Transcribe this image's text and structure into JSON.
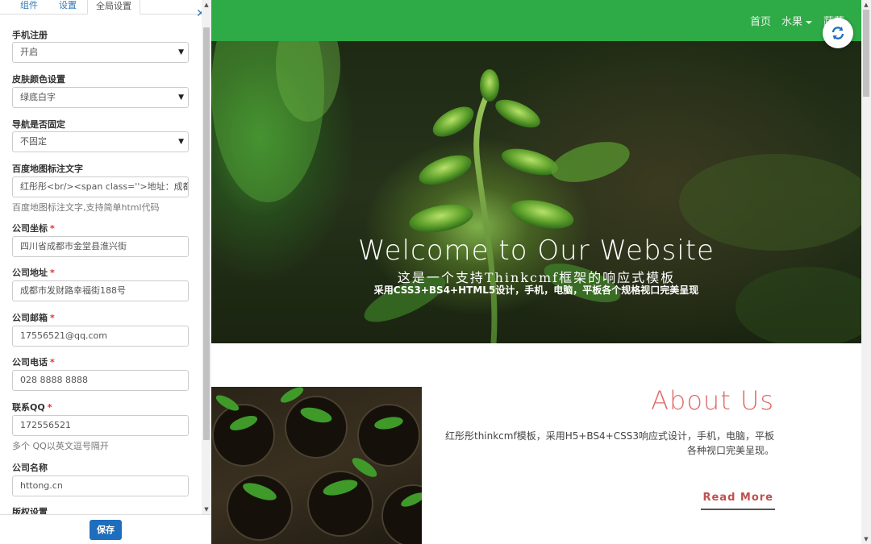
{
  "panel": {
    "tabs": [
      "组件",
      "设置",
      "全局设置"
    ],
    "fields": [
      {
        "label": "手机注册",
        "type": "select",
        "value": "开启",
        "required": false
      },
      {
        "label": "皮肤颜色设置",
        "type": "select",
        "value": "绿底白字",
        "required": false
      },
      {
        "label": "导航是否固定",
        "type": "select",
        "value": "不固定",
        "required": false
      },
      {
        "label": "百度地图标注文字",
        "type": "input",
        "value": "红彤彤<br/><span class=''>地址：成都市",
        "help": "百度地图标注文字,支持简单html代码",
        "required": false
      },
      {
        "label": "公司坐标",
        "type": "input",
        "value": "四川省成都市金堂县淮兴街",
        "required": true
      },
      {
        "label": "公司地址",
        "type": "input",
        "value": "成都市发财路幸福街188号",
        "required": true
      },
      {
        "label": "公司邮箱",
        "type": "input",
        "value": "17556521@qq.com",
        "required": true
      },
      {
        "label": "公司电话",
        "type": "input",
        "value": "028 8888 8888",
        "required": true
      },
      {
        "label": "联系QQ",
        "type": "input",
        "value": "172556521",
        "help": "多个 QQ以英文逗号隔开",
        "required": true
      },
      {
        "label": "公司名称",
        "type": "input",
        "value": "httong.cn",
        "required": false
      },
      {
        "label": "版权设置",
        "type": "label",
        "required": false
      }
    ],
    "required_mark": "*",
    "save_label": "保存"
  },
  "site": {
    "nav": {
      "home": "首页",
      "fruit": "水果",
      "vegetable": "蔬菜"
    },
    "hero": {
      "title": "Welcome to Our Website",
      "subtitle": "这是一个支持Thinkcmf框架的响应式模板",
      "description": "采用CSS3+BS4+HTML5设计，手机，电脑，平板各个规格视口完美呈现"
    },
    "about": {
      "title": "About Us",
      "text_line1": "红彤彤thinkcmf模板，采用H5+BS4+CSS3响应式设计，手机，电脑，平板",
      "text_line2": "各种视口完美呈现。",
      "read_more": "Read More"
    }
  },
  "colors": {
    "navbar": "#2eaa47",
    "save_button": "#1e6ebd",
    "about_title": "#e06a6a",
    "read_more": "#c0504d"
  },
  "icons": {
    "close": "close-icon",
    "refresh": "refresh-icon",
    "caret": "chevron-down-icon"
  }
}
